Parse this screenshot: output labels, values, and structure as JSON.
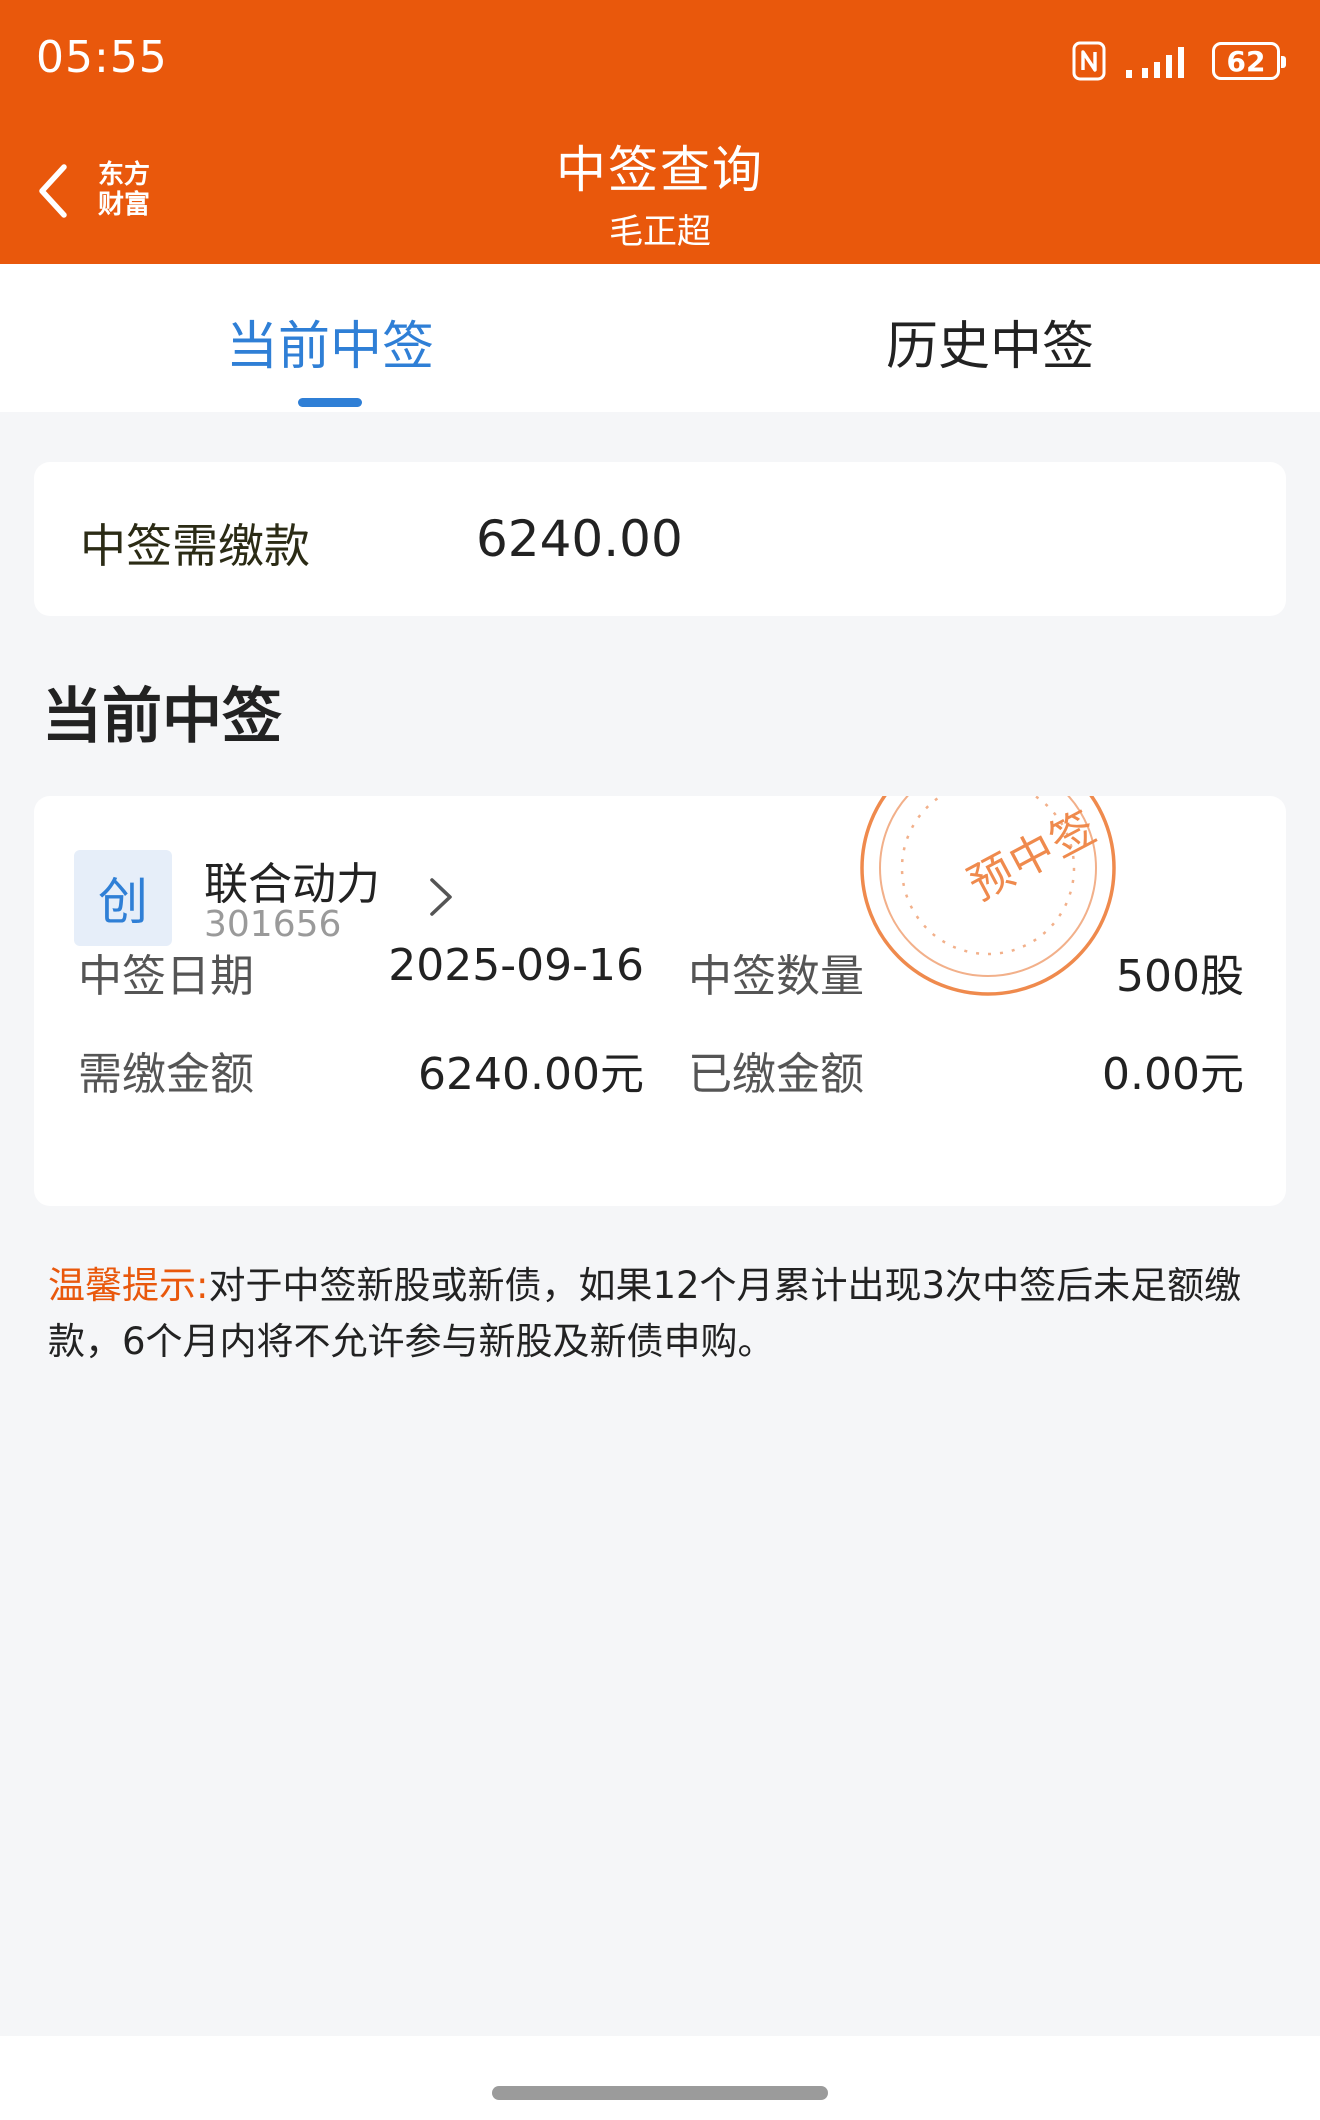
{
  "status_bar": {
    "time": "05:55",
    "battery": "62"
  },
  "header": {
    "title": "中签查询",
    "subtitle": "毛正超",
    "logo_line1": "东方",
    "logo_line2": "财富"
  },
  "tabs": [
    {
      "label": "当前中签",
      "active": true
    },
    {
      "label": "历史中签",
      "active": false
    }
  ],
  "summary": {
    "label": "中签需缴款",
    "value": "6240.00"
  },
  "section_title": "当前中签",
  "result": {
    "board_badge": "创",
    "stock_name": "联合动力",
    "stock_code": "301656",
    "stamp": "预中签",
    "date_label": "中签日期",
    "date_value": "2025-09-16",
    "qty_label": "中签数量",
    "qty_value": "500股",
    "due_label": "需缴金额",
    "due_value": "6240.00元",
    "paid_label": "已缴金额",
    "paid_value": "0.00元"
  },
  "tip": {
    "label": "温馨提示:",
    "text": "对于中签新股或新债，如果12个月累计出现3次中签后未足额缴款，6个月内将不允许参与新股及新债申购。"
  },
  "colors": {
    "brand_orange": "#e9580c",
    "accent_blue": "#2f7fd6",
    "stamp_orange": "#ef8a4d"
  }
}
